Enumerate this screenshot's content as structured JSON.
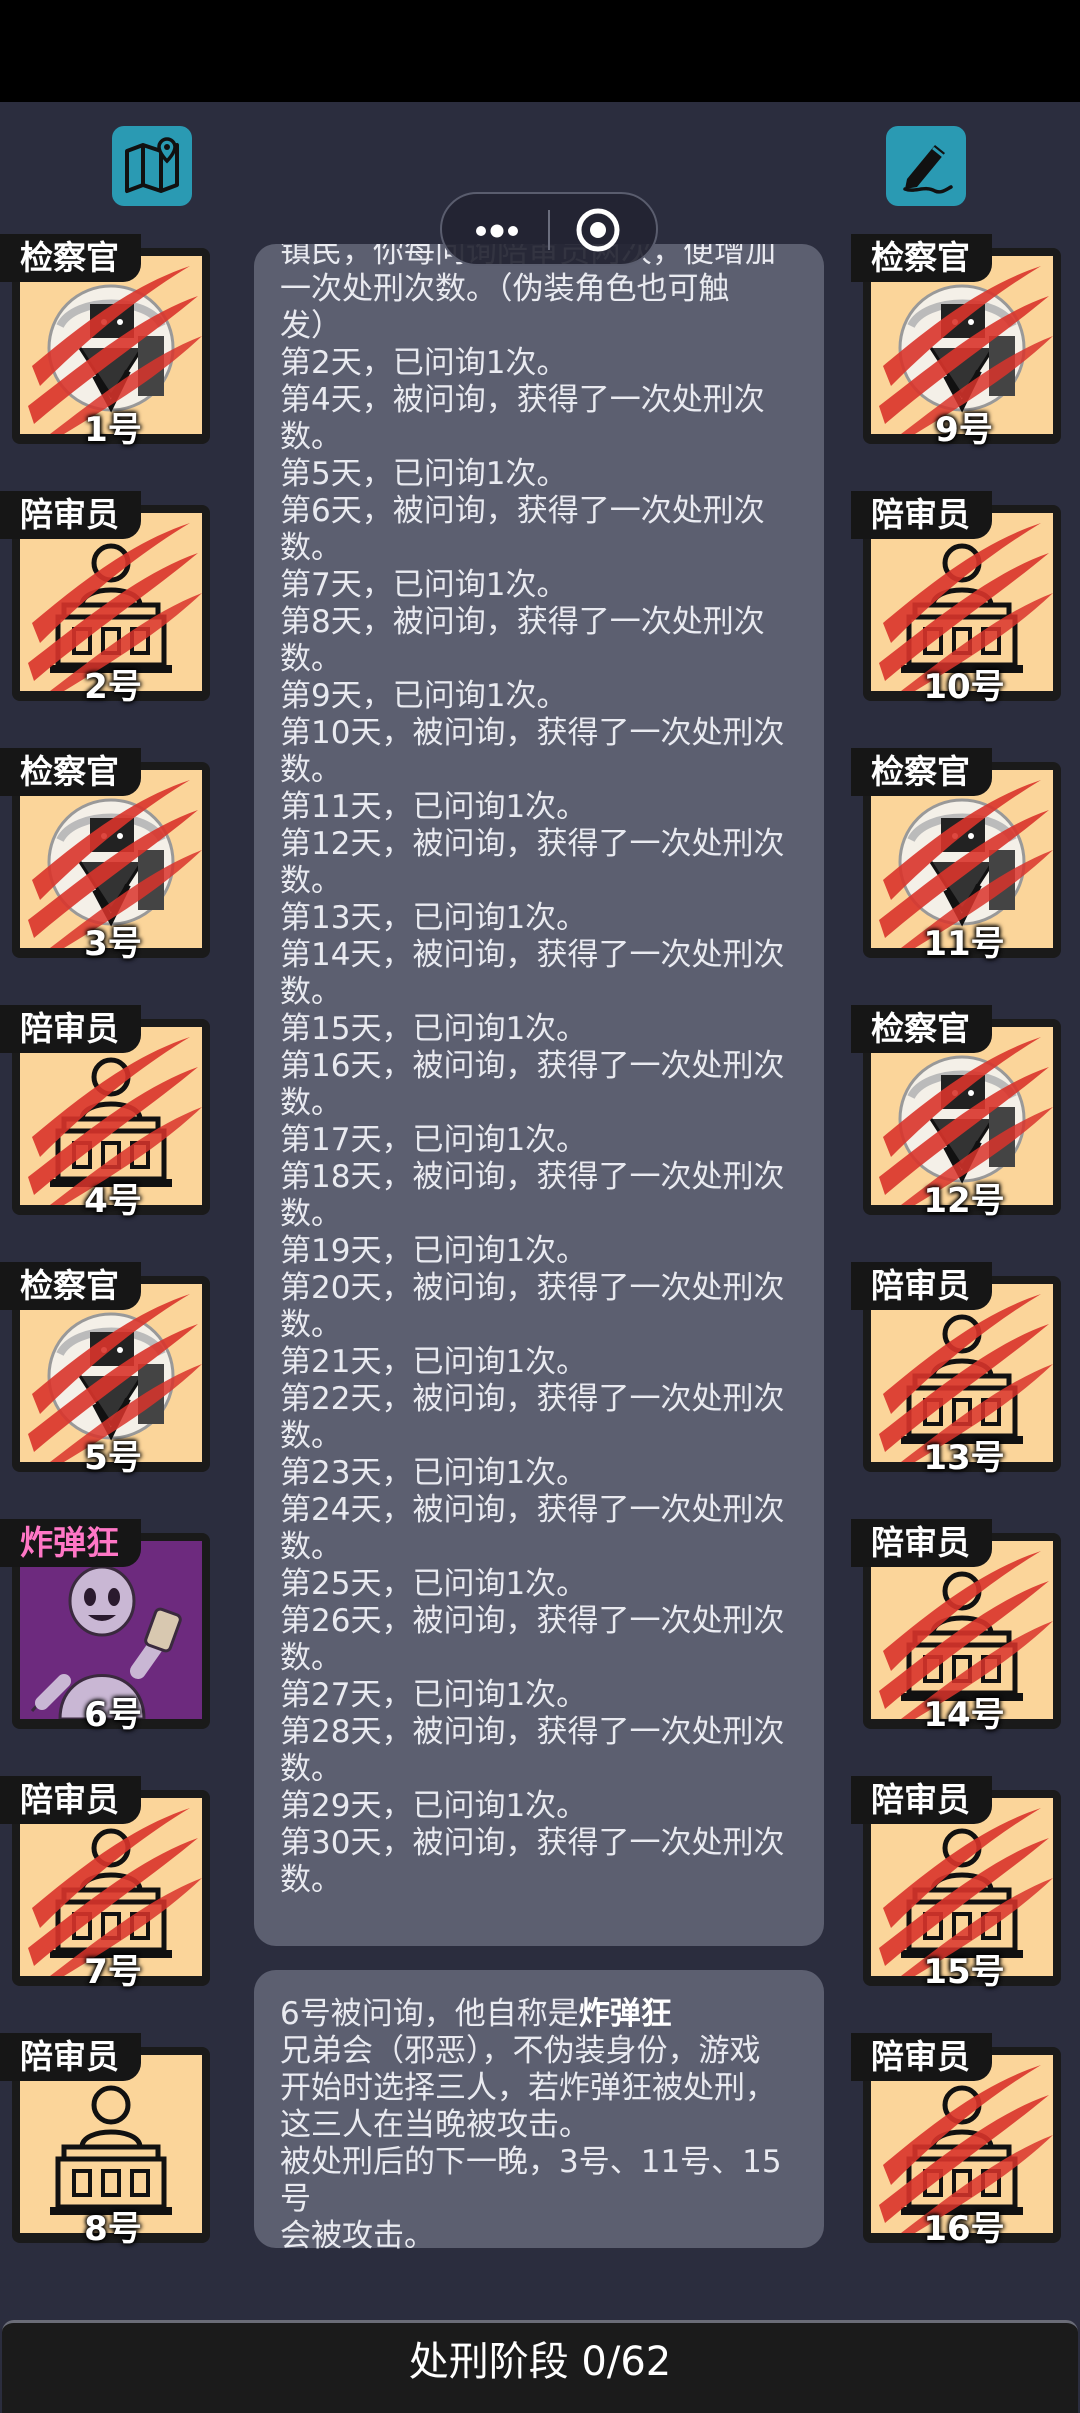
{
  "cards_left": [
    {
      "role": "检察官",
      "number": "1号",
      "type": "prosecutor",
      "crossed": true
    },
    {
      "role": "陪审员",
      "number": "2号",
      "type": "juror",
      "crossed": true
    },
    {
      "role": "检察官",
      "number": "3号",
      "type": "prosecutor",
      "crossed": true
    },
    {
      "role": "陪审员",
      "number": "4号",
      "type": "juror",
      "crossed": true
    },
    {
      "role": "检察官",
      "number": "5号",
      "type": "prosecutor",
      "crossed": true
    },
    {
      "role": "炸弹狂",
      "number": "6号",
      "type": "bomber",
      "crossed": false
    },
    {
      "role": "陪审员",
      "number": "7号",
      "type": "juror",
      "crossed": true
    },
    {
      "role": "陪审员",
      "number": "8号",
      "type": "juror",
      "crossed": false
    }
  ],
  "cards_right": [
    {
      "role": "检察官",
      "number": "9号",
      "type": "prosecutor",
      "crossed": true
    },
    {
      "role": "陪审员",
      "number": "10号",
      "type": "juror",
      "crossed": true
    },
    {
      "role": "检察官",
      "number": "11号",
      "type": "prosecutor",
      "crossed": true
    },
    {
      "role": "检察官",
      "number": "12号",
      "type": "prosecutor",
      "crossed": true
    },
    {
      "role": "陪审员",
      "number": "13号",
      "type": "juror",
      "crossed": true
    },
    {
      "role": "陪审员",
      "number": "14号",
      "type": "juror",
      "crossed": true
    },
    {
      "role": "陪审员",
      "number": "15号",
      "type": "juror",
      "crossed": true
    },
    {
      "role": "陪审员",
      "number": "16号",
      "type": "juror",
      "crossed": true
    }
  ],
  "log_lines": [
    "镇民，你每问询陪审员两次，便增加",
    "一次处刑次数。（伪装角色也可触",
    "发）",
    "第2天，已问询1次。",
    "第4天，被问询，获得了一次处刑次",
    "数。",
    "第5天，已问询1次。",
    "第6天，被问询，获得了一次处刑次",
    "数。",
    "第7天，已问询1次。",
    "第8天，被问询，获得了一次处刑次",
    "数。",
    "第9天，已问询1次。",
    "第10天，被问询，获得了一次处刑次",
    "数。",
    "第11天，已问询1次。",
    "第12天，被问询，获得了一次处刑次",
    "数。",
    "第13天，已问询1次。",
    "第14天，被问询，获得了一次处刑次",
    "数。",
    "第15天，已问询1次。",
    "第16天，被问询，获得了一次处刑次",
    "数。",
    "第17天，已问询1次。",
    "第18天，被问询，获得了一次处刑次",
    "数。",
    "第19天，已问询1次。",
    "第20天，被问询，获得了一次处刑次",
    "数。",
    "第21天，已问询1次。",
    "第22天，被问询，获得了一次处刑次",
    "数。",
    "第23天，已问询1次。",
    "第24天，被问询，获得了一次处刑次",
    "数。",
    "第25天，已问询1次。",
    "第26天，被问询，获得了一次处刑次",
    "数。",
    "第27天，已问询1次。",
    "第28天，被问询，获得了一次处刑次",
    "数。",
    "第29天，已问询1次。",
    "第30天，被问询，获得了一次处刑次",
    "数。"
  ],
  "info": {
    "prefix": "6号被问询，他自称是",
    "claimed_role": "炸弹狂",
    "lines": [
      "兄弟会（邪恶），不伪装身份，游戏",
      "开始时选择三人，若炸弹狂被处刑，",
      "这三人在当晚被攻击。",
      "被处刑后的下一晚，3号、11号、15号",
      "会被攻击。"
    ]
  },
  "status": "处刑阶段 0/62",
  "icons": {
    "left": "map-icon",
    "right": "pen-icon"
  },
  "colors": {
    "background": "#2b2d3e",
    "panel": "#5c5f70",
    "card": "#fbd59a",
    "bomber": "#6d2a7e",
    "tag_bomber": "#ff77c6",
    "slash": "#d9342b",
    "icon_button": "#2a9ab3"
  }
}
